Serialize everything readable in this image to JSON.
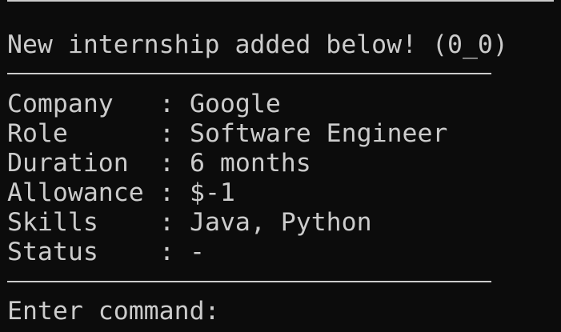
{
  "terminal": {
    "rule_top": "------------------------------------",
    "header": "New internship added below! (0_0)",
    "rule_mid": "--------------------------------",
    "fields": [
      {
        "key": "Company",
        "sep": ":",
        "value": "Google"
      },
      {
        "key": "Role",
        "sep": ":",
        "value": "Software Engineer"
      },
      {
        "key": "Duration",
        "sep": ":",
        "value": "6 months"
      },
      {
        "key": "Allowance",
        "sep": ":",
        "value": "$-1"
      },
      {
        "key": "Skills",
        "sep": ":",
        "value": "Java, Python"
      },
      {
        "key": "Status",
        "sep": ":",
        "value": "-"
      }
    ],
    "rule_bot": "--------------------------------",
    "prompt": "Enter command:"
  },
  "colors": {
    "background": "#0c0c0c",
    "foreground": "#cccccc"
  }
}
